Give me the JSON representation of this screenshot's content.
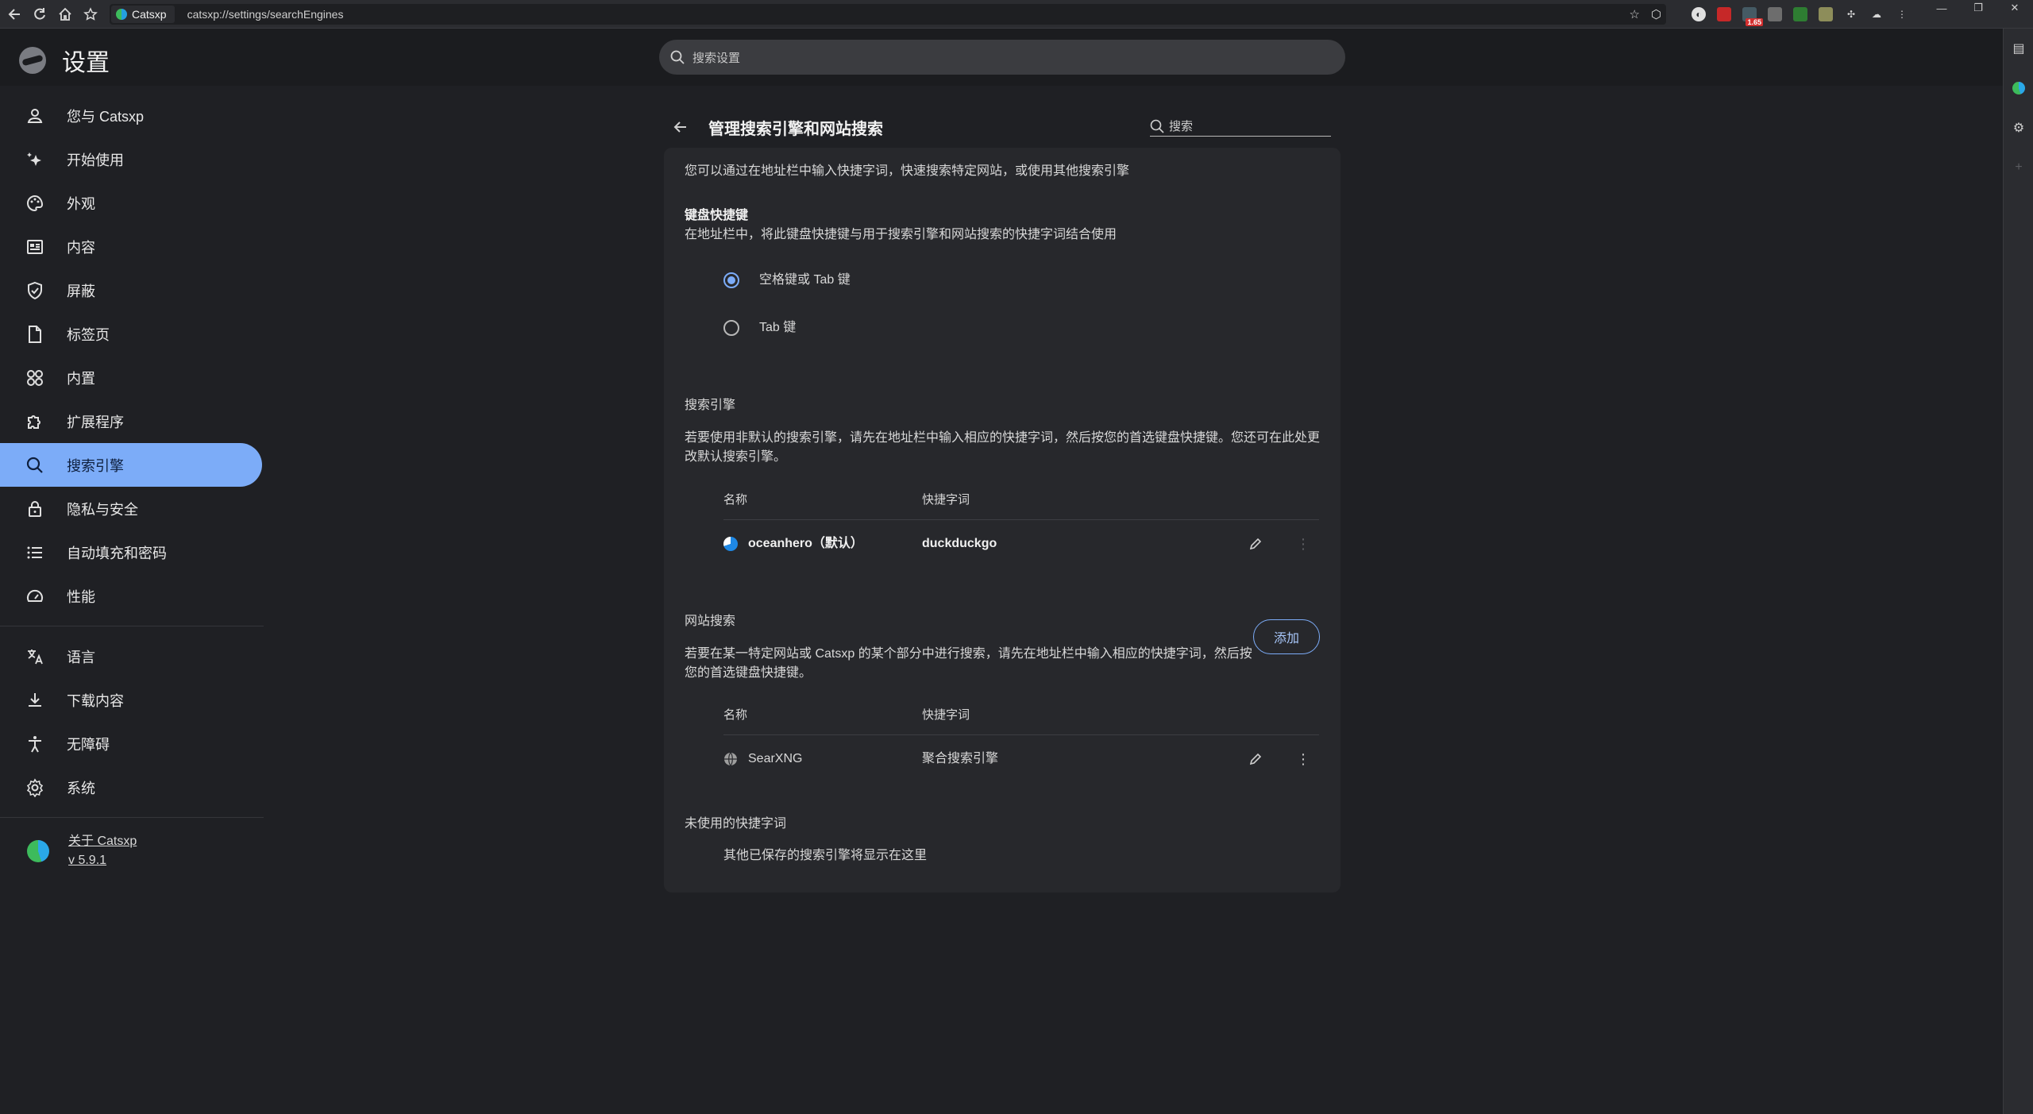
{
  "browser": {
    "tab_title": "Catsxp",
    "url": "catsxp://settings/searchEngines",
    "ext_badge": "1.65"
  },
  "header": {
    "title": "设置",
    "search_placeholder": "搜索设置"
  },
  "sidebar": {
    "items": [
      {
        "label": "您与 Catsxp",
        "icon": "person-icon"
      },
      {
        "label": "开始使用",
        "icon": "sparkle-icon"
      },
      {
        "label": "外观",
        "icon": "palette-icon"
      },
      {
        "label": "内容",
        "icon": "content-icon"
      },
      {
        "label": "屏蔽",
        "icon": "shield-icon"
      },
      {
        "label": "标签页",
        "icon": "page-icon"
      },
      {
        "label": "内置",
        "icon": "grid-icon"
      },
      {
        "label": "扩展程序",
        "icon": "puzzle-icon"
      },
      {
        "label": "搜索引擎",
        "icon": "search-icon"
      },
      {
        "label": "隐私与安全",
        "icon": "lock-icon"
      },
      {
        "label": "自动填充和密码",
        "icon": "list-icon"
      },
      {
        "label": "性能",
        "icon": "gauge-icon"
      }
    ],
    "items2": [
      {
        "label": "语言",
        "icon": "translate-icon"
      },
      {
        "label": "下载内容",
        "icon": "download-icon"
      },
      {
        "label": "无障碍",
        "icon": "accessibility-icon"
      },
      {
        "label": "系统",
        "icon": "gear-icon"
      }
    ],
    "about": {
      "label": "关于 Catsxp",
      "version": "v 5.9.1"
    }
  },
  "page": {
    "title": "管理搜索引擎和网站搜索",
    "search_placeholder": "搜索",
    "intro": "您可以通过在地址栏中输入快捷字词，快速搜索特定网站，或使用其他搜索引擎",
    "keyboard": {
      "heading": "键盘快捷键",
      "desc": "在地址栏中，将此键盘快捷键与用于搜索引擎和网站搜索的快捷字词结合使用",
      "option1": "空格键或 Tab 键",
      "option2": "Tab 键",
      "selected": "option1"
    },
    "engines": {
      "heading": "搜索引擎",
      "desc": "若要使用非默认的搜索引擎，请先在地址栏中输入相应的快捷字词，然后按您的首选键盘快捷键。您还可在此处更改默认搜索引擎。",
      "col_name": "名称",
      "col_keyword": "快捷字词",
      "rows": [
        {
          "name": "oceanhero（默认）",
          "keyword": "duckduckgo"
        }
      ]
    },
    "sites": {
      "heading": "网站搜索",
      "desc": "若要在某一特定网站或 Catsxp 的某个部分中进行搜索，请先在地址栏中输入相应的快捷字词，然后按您的首选键盘快捷键。",
      "add_label": "添加",
      "col_name": "名称",
      "col_keyword": "快捷字词",
      "rows": [
        {
          "name": "SearXNG",
          "keyword": "聚合搜索引擎"
        }
      ]
    },
    "unused": {
      "heading": "未使用的快捷字词",
      "empty": "其他已保存的搜索引擎将显示在这里"
    }
  },
  "colors": {
    "accent": "#7cacf8",
    "background": "#1f2024",
    "card": "#27282c"
  }
}
